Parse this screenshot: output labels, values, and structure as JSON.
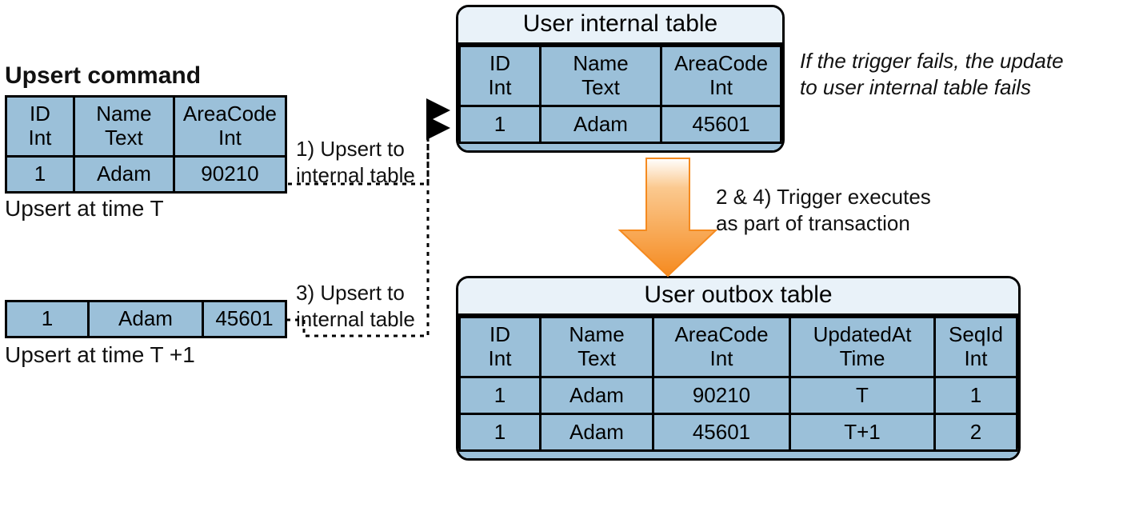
{
  "left": {
    "heading": "Upsert command",
    "headers": {
      "id1": "ID",
      "id2": "Int",
      "name1": "Name",
      "name2": "Text",
      "code1": "AreaCode",
      "code2": "Int"
    },
    "row1": {
      "id": "1",
      "name": "Adam",
      "code": "90210"
    },
    "cap1": "Upsert at time T",
    "row2": {
      "id": "1",
      "name": "Adam",
      "code": "45601"
    },
    "cap2": "Upsert at time T +1"
  },
  "internal": {
    "title": "User internal table",
    "headers": {
      "id1": "ID",
      "id2": "Int",
      "name1": "Name",
      "name2": "Text",
      "code1": "AreaCode",
      "code2": "Int"
    },
    "row": {
      "id": "1",
      "name": "Adam",
      "code": "45601"
    }
  },
  "outbox": {
    "title": "User outbox table",
    "headers": {
      "id1": "ID",
      "id2": "Int",
      "name1": "Name",
      "name2": "Text",
      "code1": "AreaCode",
      "code2": "Int",
      "upd1": "UpdatedAt",
      "upd2": "Time",
      "seq1": "SeqId",
      "seq2": "Int"
    },
    "r1": {
      "id": "1",
      "name": "Adam",
      "code": "90210",
      "upd": "T",
      "seq": "1"
    },
    "r2": {
      "id": "1",
      "name": "Adam",
      "code": "45601",
      "upd": "T+1",
      "seq": "2"
    }
  },
  "labels": {
    "step1a": "1) Upsert to",
    "step1b": "internal table",
    "step3a": "3) Upsert to",
    "step3b": "internal table",
    "step24a": "2 & 4) Trigger executes",
    "step24b": "as part of transaction",
    "noteA": "If the trigger fails, the update",
    "noteB": "to user internal table fails"
  }
}
